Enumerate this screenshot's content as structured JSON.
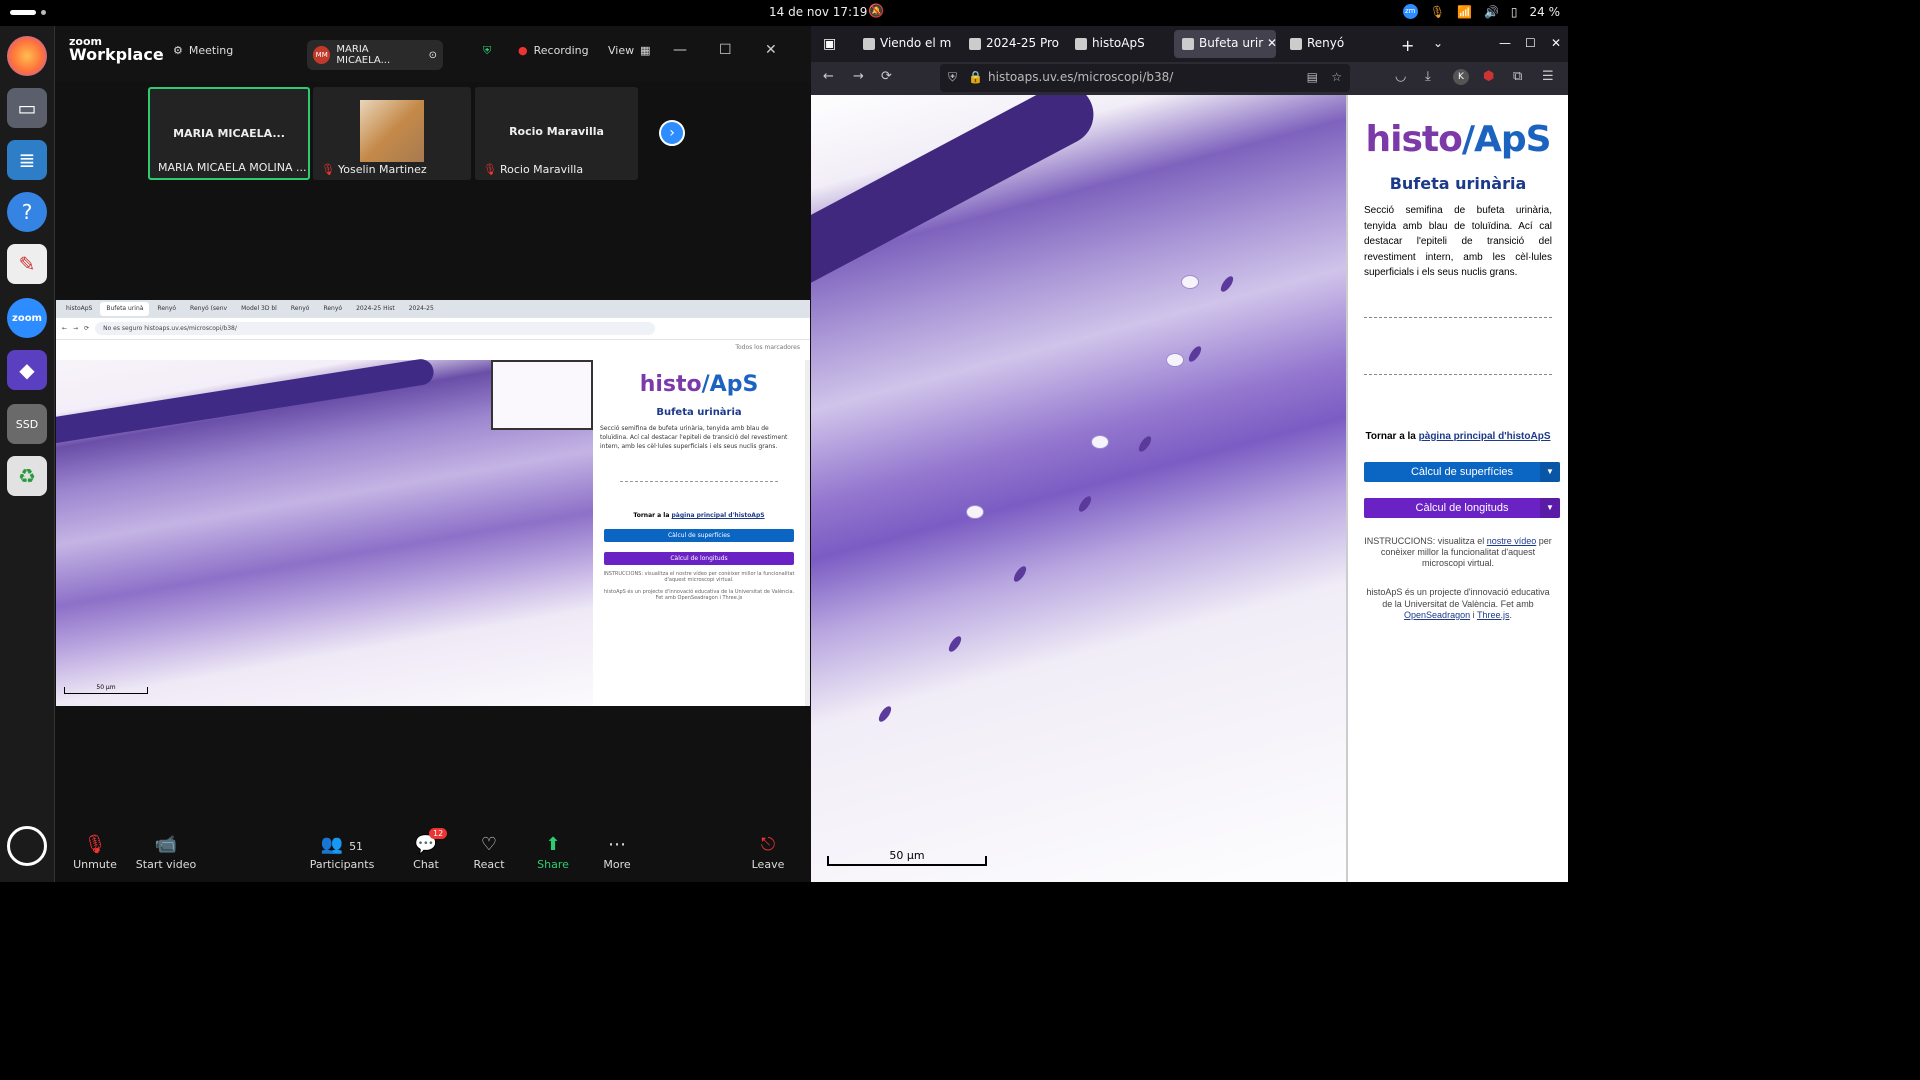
{
  "system": {
    "datetime": "14 de nov  17:19",
    "battery": "24 %",
    "tray_zoom_label": "zm"
  },
  "dock": {
    "items": [
      {
        "name": "firefox",
        "color": "#ff7139"
      },
      {
        "name": "files",
        "color": "#5a5f6b"
      },
      {
        "name": "writer",
        "color": "#2d7ec7"
      },
      {
        "name": "help",
        "color": "#3584e4"
      },
      {
        "name": "text-editor",
        "color": "#eeeeee"
      },
      {
        "name": "zoom",
        "color": "#2d8cff"
      },
      {
        "name": "app-purple",
        "color": "#5a3fc0"
      },
      {
        "name": "ssd",
        "color": "#6a6a6a"
      },
      {
        "name": "trash",
        "color": "#e2e2e2"
      }
    ],
    "zoom_label": "zoom",
    "ssd_label": "SSD"
  },
  "zoom": {
    "logo_line1": "zoom",
    "logo_line2": "Workplace",
    "meeting_label": "Meeting",
    "share_pill_label": "MARIA MICAELA...",
    "share_pill_initials": "MM",
    "recording_label": "Recording",
    "view_label": "View",
    "participants": [
      {
        "bigname": "MARIA MICAELA...",
        "label": "MARIA MICAELA MOLINA ...",
        "active": true,
        "muted": false
      },
      {
        "bigname": "",
        "label": "Yoselin Martinez",
        "active": false,
        "muted": true
      },
      {
        "bigname": "Rocio Maravilla",
        "label": "Rocio Maravilla",
        "active": false,
        "muted": true
      }
    ],
    "toolbar": {
      "unmute": "Unmute",
      "start_video": "Start video",
      "participants": "Participants",
      "participants_count": "51",
      "chat": "Chat",
      "chat_badge": "12",
      "react": "React",
      "share": "Share",
      "more": "More",
      "leave": "Leave"
    },
    "share_screen": {
      "tabs": [
        "histoApS",
        "Bufeta urinà",
        "Renyó",
        "Renyó (senv",
        "Model 3D bl",
        "Renyó",
        "Renyó",
        "2024-25 Hist",
        "2024-25"
      ],
      "not_secure": "No es seguro",
      "url": "histoaps.uv.es/microscopi/b38/",
      "bookmarks": "Todos los marcadores",
      "scale": "50 µm",
      "title": "Bufeta urinària",
      "description": "Secció semifina de bufeta urinària, tenyida amb blau de toluïdina. Ací cal destacar l'epiteli de transició del revestiment intern, amb les cèl·lules superficials i els seus nuclis grans.",
      "back_prefix": "Tornar a la ",
      "back_link": "pàgina principal d'histoApS",
      "btn_surfaces": "Càlcul de superfícies",
      "btn_lengths": "Càlcul de longituds",
      "instructions": "INSTRUCCIONS: visualitza el nostre vídeo per conèixer millor la funcionalitat d'aquest microscopi virtual.",
      "credits": "histoApS és un projecte d'innovació educativa de la Universitat de València. Fet amb OpenSeadragon i Three.js"
    }
  },
  "firefox": {
    "tabs": [
      {
        "label": "Viendo el m",
        "active": false
      },
      {
        "label": "2024-25 Pro",
        "active": false
      },
      {
        "label": "histoApS",
        "active": false
      },
      {
        "label": "Bufeta urir",
        "active": true
      },
      {
        "label": "Renyó",
        "active": false
      }
    ],
    "url": "histoaps.uv.es/microscopi/b38/",
    "profile_initial": "K",
    "scale": "50 µm",
    "logo_a": "histo",
    "logo_b": "ApS",
    "title": "Bufeta urinària",
    "description": "Secció semifina de bufeta urinària, tenyida amb blau de toluïdina. Ací cal destacar l'epiteli de transició del revestiment intern, amb les cèl·lules superficials i els seus nuclis grans.",
    "back_prefix": "Tornar a la ",
    "back_link": "pàgina principal d'histoApS",
    "btn_surfaces": "Càlcul de superfícies",
    "btn_lengths": "Càlcul de longituds",
    "btn_surfaces_color": "#0b66c3",
    "btn_lengths_color": "#6a22c4",
    "instr_prefix": "INSTRUCCIONS: visualitza el ",
    "instr_link": "nostre vídeo",
    "instr_suffix": " per conèixer millor la funcionalitat d'aquest microscopi virtual.",
    "credits_prefix": "histoApS és un projecte d'innovació educativa de la Universitat de València. Fet amb ",
    "credits_link1": "OpenSeadragon",
    "credits_mid": " i ",
    "credits_link2": "Three.js",
    "credits_suffix": "."
  }
}
